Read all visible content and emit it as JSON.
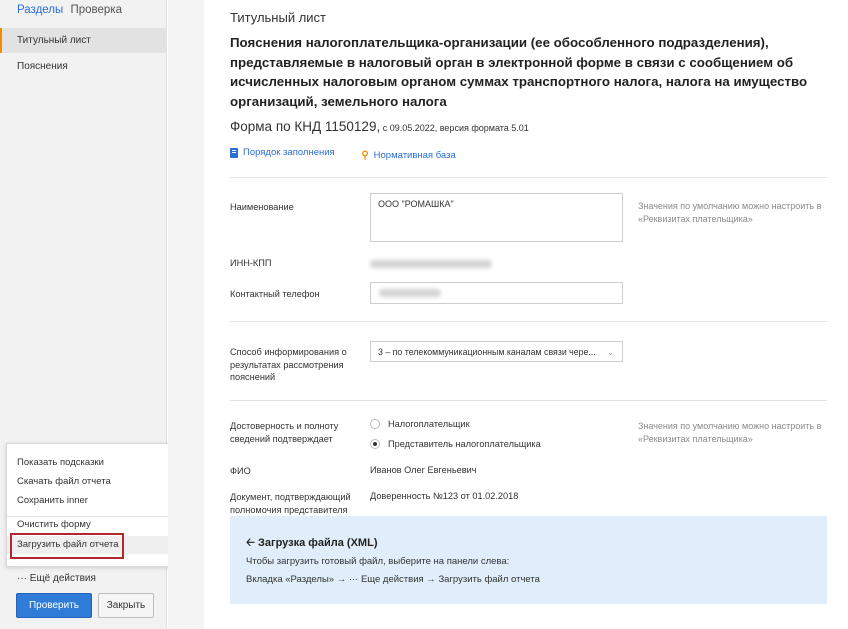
{
  "sidebar": {
    "tabs": [
      {
        "label": "Разделы",
        "active": true
      },
      {
        "label": "Проверка",
        "active": false
      }
    ],
    "items": [
      {
        "label": "Титульный лист",
        "active": true
      },
      {
        "label": "Пояснения",
        "active": false
      }
    ],
    "menu": {
      "items": [
        "Показать подсказки",
        "Скачать файл отчета",
        "Сохранить inner",
        "Очистить форму",
        "Загрузить файл отчета"
      ]
    },
    "more_actions": "··· Ещё действия",
    "check_button": "Проверить",
    "close_button": "Закрыть"
  },
  "main": {
    "heading": "Титульный лист",
    "title": "Пояснения налогоплательщика-организации (ее обособленного подразделения), представляемые в налоговый орган в электронной форме в связи с сообщением об исчисленных налоговым органом суммах транспортного налога, налога на имущество организаций, земельного налога",
    "knd": "Форма по КНД 1150129,",
    "knd_sub": " с 09.05.2022, версия формата 5.01",
    "links": {
      "fill_order": "Порядок заполнения",
      "normative": "Нормативная база"
    },
    "fields": {
      "name_label": "Наименование",
      "name_value": "ООО \"РОМАШКА\"",
      "name_hint": "Значения по умолчанию можно настроить в «Реквизитах плательщика»",
      "inn_label": "ИНН-КПП",
      "phone_label": "Контактный телефон",
      "inform_label": "Способ информирования о результатах рассмотрения пояснений",
      "inform_value": "3 – по телекоммуникационным каналам связи чере...",
      "confirm_label": "Достоверность и полноту сведений подтверждает",
      "radio_taxpayer": "Налогоплательщик",
      "radio_representative": "Представитель налогоплательщика",
      "confirm_hint": "Значения по умолчанию можно настроить в «Реквизитах плательщика»",
      "fio_label": "ФИО",
      "fio_value": "Иванов Олег Евгеньевич",
      "doc_label": "Документ, подтверждающий полномочия представителя",
      "doc_value": "Доверенность №123 от 01.02.2018"
    },
    "info": {
      "title": "Загрузка файла (XML)",
      "line1": "Чтобы загрузить готовый файл, выберите на панели слева:",
      "line2": "Вкладка «Разделы» → ··· Еще действия → Загрузить файл отчета"
    }
  },
  "colors": {
    "accent": "#2f7bd8",
    "active_marker": "#f08a00",
    "highlight": "#b0282e",
    "info_bg": "#dfeefa"
  }
}
